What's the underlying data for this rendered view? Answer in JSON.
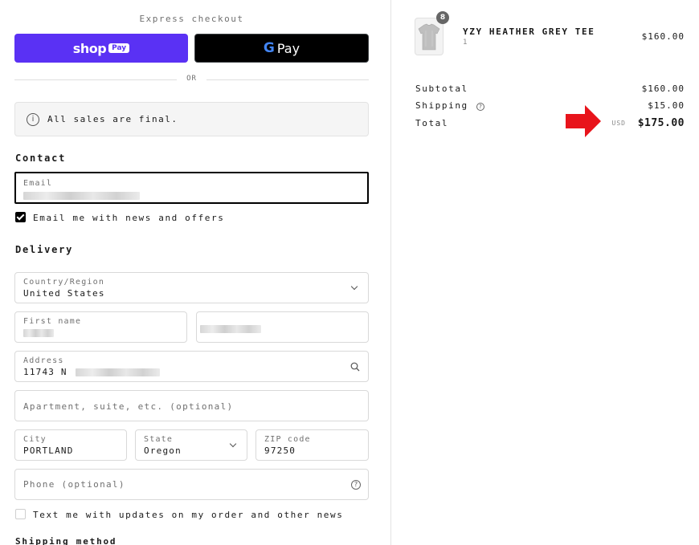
{
  "express": {
    "title": "Express checkout",
    "shop_pay_text": "shop",
    "shop_pay_badge": "Pay",
    "gpay_g": "G",
    "gpay_text": "Pay",
    "or_label": "OR"
  },
  "notice": {
    "icon": "info-icon",
    "text": "All sales are final."
  },
  "contact": {
    "title": "Contact",
    "email_label": "Email",
    "email_value": "",
    "newsletter_label": "Email me with news and offers",
    "newsletter_checked": true
  },
  "delivery": {
    "title": "Delivery",
    "country_label": "Country/Region",
    "country_value": "United States",
    "first_name_label": "First name",
    "first_name_value": "",
    "last_name_value": "",
    "address_label": "Address",
    "address_value": "11743 N",
    "apartment_placeholder": "Apartment, suite, etc. (optional)",
    "city_label": "City",
    "city_value": "PORTLAND",
    "state_label": "State",
    "state_value": "Oregon",
    "zip_label": "ZIP code",
    "zip_value": "97250",
    "phone_placeholder": "Phone (optional)",
    "sms_label": "Text me with updates on my order and other news",
    "sms_checked": false
  },
  "shipping_method": {
    "title": "Shipping method"
  },
  "order": {
    "product_name": "YZY HEATHER GREY TEE",
    "product_variant": "1",
    "quantity_badge": "8",
    "product_price": "$160.00",
    "subtotal_label": "Subtotal",
    "subtotal_value": "$160.00",
    "shipping_label": "Shipping",
    "shipping_value": "$15.00",
    "total_label": "Total",
    "total_currency": "USD",
    "total_value": "$175.00"
  },
  "colors": {
    "shop_pay": "#5a31f4",
    "gpay": "#000000",
    "arrow": "#e8141b"
  }
}
